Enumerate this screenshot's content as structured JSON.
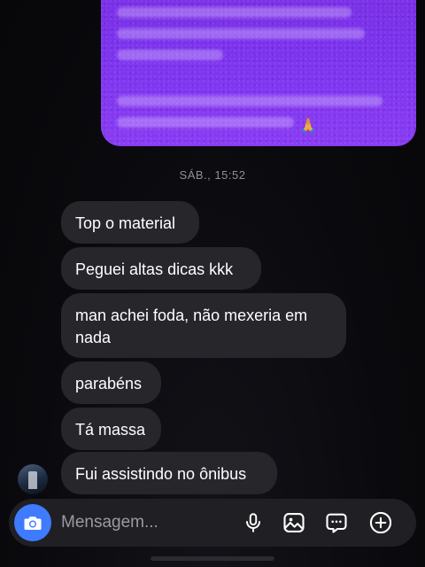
{
  "conversation": {
    "sent_message_emoji": "🙏",
    "timestamp": "SÁB., 15:52",
    "received_messages": [
      "Top o material",
      "Peguei altas dicas kkk",
      "man achei foda, não mexeria em nada",
      "parabéns",
      "Tá massa",
      "Fui assistindo no ônibus"
    ]
  },
  "composer": {
    "placeholder": "Mensagem...",
    "icons": [
      "camera-icon",
      "microphone-icon",
      "image-icon",
      "sticker-icon",
      "add-icon"
    ]
  },
  "colors": {
    "sent_bubble": "#7d34f0",
    "received_bubble": "#26262b",
    "camera_button": "#3f7bff",
    "background": "#08080c"
  }
}
